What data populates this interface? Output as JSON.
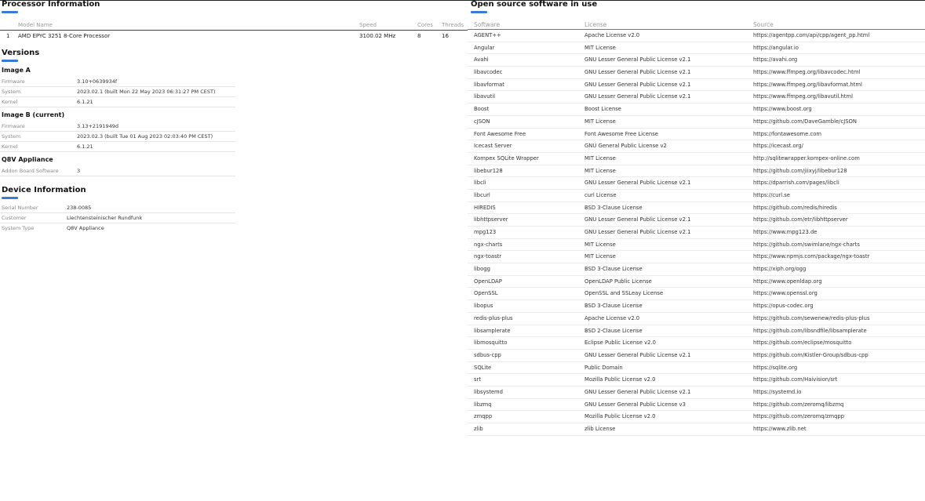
{
  "processor": {
    "title": "Processor Information",
    "headers": {
      "model": "Model Name",
      "speed": "Speed",
      "cores": "Cores",
      "threads": "Threads"
    },
    "rows": [
      {
        "index": "1",
        "model": "AMD EPYC 3251 8-Core Processor",
        "speed": "3100.02 MHz",
        "cores": "8",
        "threads": "16"
      }
    ]
  },
  "versions": {
    "title": "Versions",
    "image_a": {
      "title": "Image A",
      "firmware_label": "Firmware",
      "firmware": "3.10+0639934f",
      "system_label": "System",
      "system": "2023.02.1 (built Mon 22 May 2023 06:31:27 PM CEST)",
      "kernel_label": "Kernel",
      "kernel": "6.1.21"
    },
    "image_b": {
      "title": "Image B (current)",
      "firmware_label": "Firmware",
      "firmware": "3.13+2191949d",
      "system_label": "System",
      "system": "2023.02.3 (built Tue 01 Aug 2023 02:03:40 PM CEST)",
      "kernel_label": "Kernel",
      "kernel": "6.1.21"
    },
    "q8v": {
      "title": "Q8V Appliance",
      "addon_label": "Addon Board Software",
      "addon": "3"
    }
  },
  "device": {
    "title": "Device Information",
    "serial_label": "Serial Number",
    "serial": "238-0085",
    "customer_label": "Customer",
    "customer": "Liechtensteinischer Rundfunk",
    "type_label": "System Type",
    "type": "Q8V Appliance"
  },
  "opensource": {
    "title": "Open source software in use",
    "headers": {
      "software": "Software",
      "license": "License",
      "source": "Source"
    },
    "rows": [
      {
        "software": "AGENT++",
        "license": "Apache License v2.0",
        "source": "https://agentpp.com/api/cpp/agent_pp.html"
      },
      {
        "software": "Angular",
        "license": "MIT License",
        "source": "https://angular.io"
      },
      {
        "software": "Avahi",
        "license": "GNU Lesser General Public License v2.1",
        "source": "https://avahi.org"
      },
      {
        "software": "libavcodec",
        "license": "GNU Lesser General Public License v2.1",
        "source": "https://www.ffmpeg.org/libavcodec.html"
      },
      {
        "software": "libavformat",
        "license": "GNU Lesser General Public License v2.1",
        "source": "https://www.ffmpeg.org/libavformat.html"
      },
      {
        "software": "libavutil",
        "license": "GNU Lesser General Public License v2.1",
        "source": "https://www.ffmpeg.org/libavutil.html"
      },
      {
        "software": "Boost",
        "license": "Boost License",
        "source": "https://www.boost.org"
      },
      {
        "software": "cJSON",
        "license": "MIT License",
        "source": "https://github.com/DaveGamble/cJSON"
      },
      {
        "software": "Font Awesome Free",
        "license": "Font Awesome Free License",
        "source": "https://fontawesome.com"
      },
      {
        "software": "Icecast Server",
        "license": "GNU General Public License v2",
        "source": "https://icecast.org/"
      },
      {
        "software": "Kompex SQLite Wrapper",
        "license": "MIT License",
        "source": "http://sqlitewrapper.kompex-online.com"
      },
      {
        "software": "libebur128",
        "license": "MIT License",
        "source": "https://github.com/jiixyj/libebur128"
      },
      {
        "software": "libcli",
        "license": "GNU Lesser General Public License v2.1",
        "source": "https://dparrish.com/pages/libcli"
      },
      {
        "software": "libcurl",
        "license": "curl License",
        "source": "https://curl.se"
      },
      {
        "software": "HIREDIS",
        "license": "BSD 3-Clause License",
        "source": "https://github.com/redis/hiredis"
      },
      {
        "software": "libhttpserver",
        "license": "GNU Lesser General Public License v2.1",
        "source": "https://github.com/etr/libhttpserver"
      },
      {
        "software": "mpg123",
        "license": "GNU Lesser General Public License v2.1",
        "source": "https://www.mpg123.de"
      },
      {
        "software": "ngx-charts",
        "license": "MIT License",
        "source": "https://github.com/swimlane/ngx-charts"
      },
      {
        "software": "ngx-toastr",
        "license": "MIT License",
        "source": "https://www.npmjs.com/package/ngx-toastr"
      },
      {
        "software": "libogg",
        "license": "BSD 3-Clause License",
        "source": "https://xiph.org/ogg"
      },
      {
        "software": "OpenLDAP",
        "license": "OpenLDAP Public License",
        "source": "https://www.openldap.org"
      },
      {
        "software": "OpenSSL",
        "license": "OpenSSL and SSLeay License",
        "source": "https://www.openssl.org"
      },
      {
        "software": "libopus",
        "license": "BSD 3-Clause License",
        "source": "https://opus-codec.org"
      },
      {
        "software": "redis-plus-plus",
        "license": "Apache License v2.0",
        "source": "https://github.com/sewenew/redis-plus-plus"
      },
      {
        "software": "libsamplerate",
        "license": "BSD 2-Clause License",
        "source": "https://github.com/libsndfile/libsamplerate"
      },
      {
        "software": "libmosquitto",
        "license": "Eclipse Public License v2.0",
        "source": "https://github.com/eclipse/mosquitto"
      },
      {
        "software": "sdbus-cpp",
        "license": "GNU Lesser General Public License v2.1",
        "source": "https://github.com/Kistler-Group/sdbus-cpp"
      },
      {
        "software": "SQLite",
        "license": "Public Domain",
        "source": "https://sqlite.org"
      },
      {
        "software": "srt",
        "license": "Mozilla Public License v2.0",
        "source": "https://github.com/Haivision/srt"
      },
      {
        "software": "libsystemd",
        "license": "GNU Lesser General Public License v2.1",
        "source": "https://systemd.io"
      },
      {
        "software": "libzmq",
        "license": "GNU Lesser General Public License v3",
        "source": "https://github.com/zeromq/libzmq"
      },
      {
        "software": "zmqpp",
        "license": "Mozilla Public License v2.0",
        "source": "https://github.com/zeromq/zmqpp"
      },
      {
        "software": "zlib",
        "license": "zlib License",
        "source": "https://www.zlib.net"
      }
    ]
  }
}
